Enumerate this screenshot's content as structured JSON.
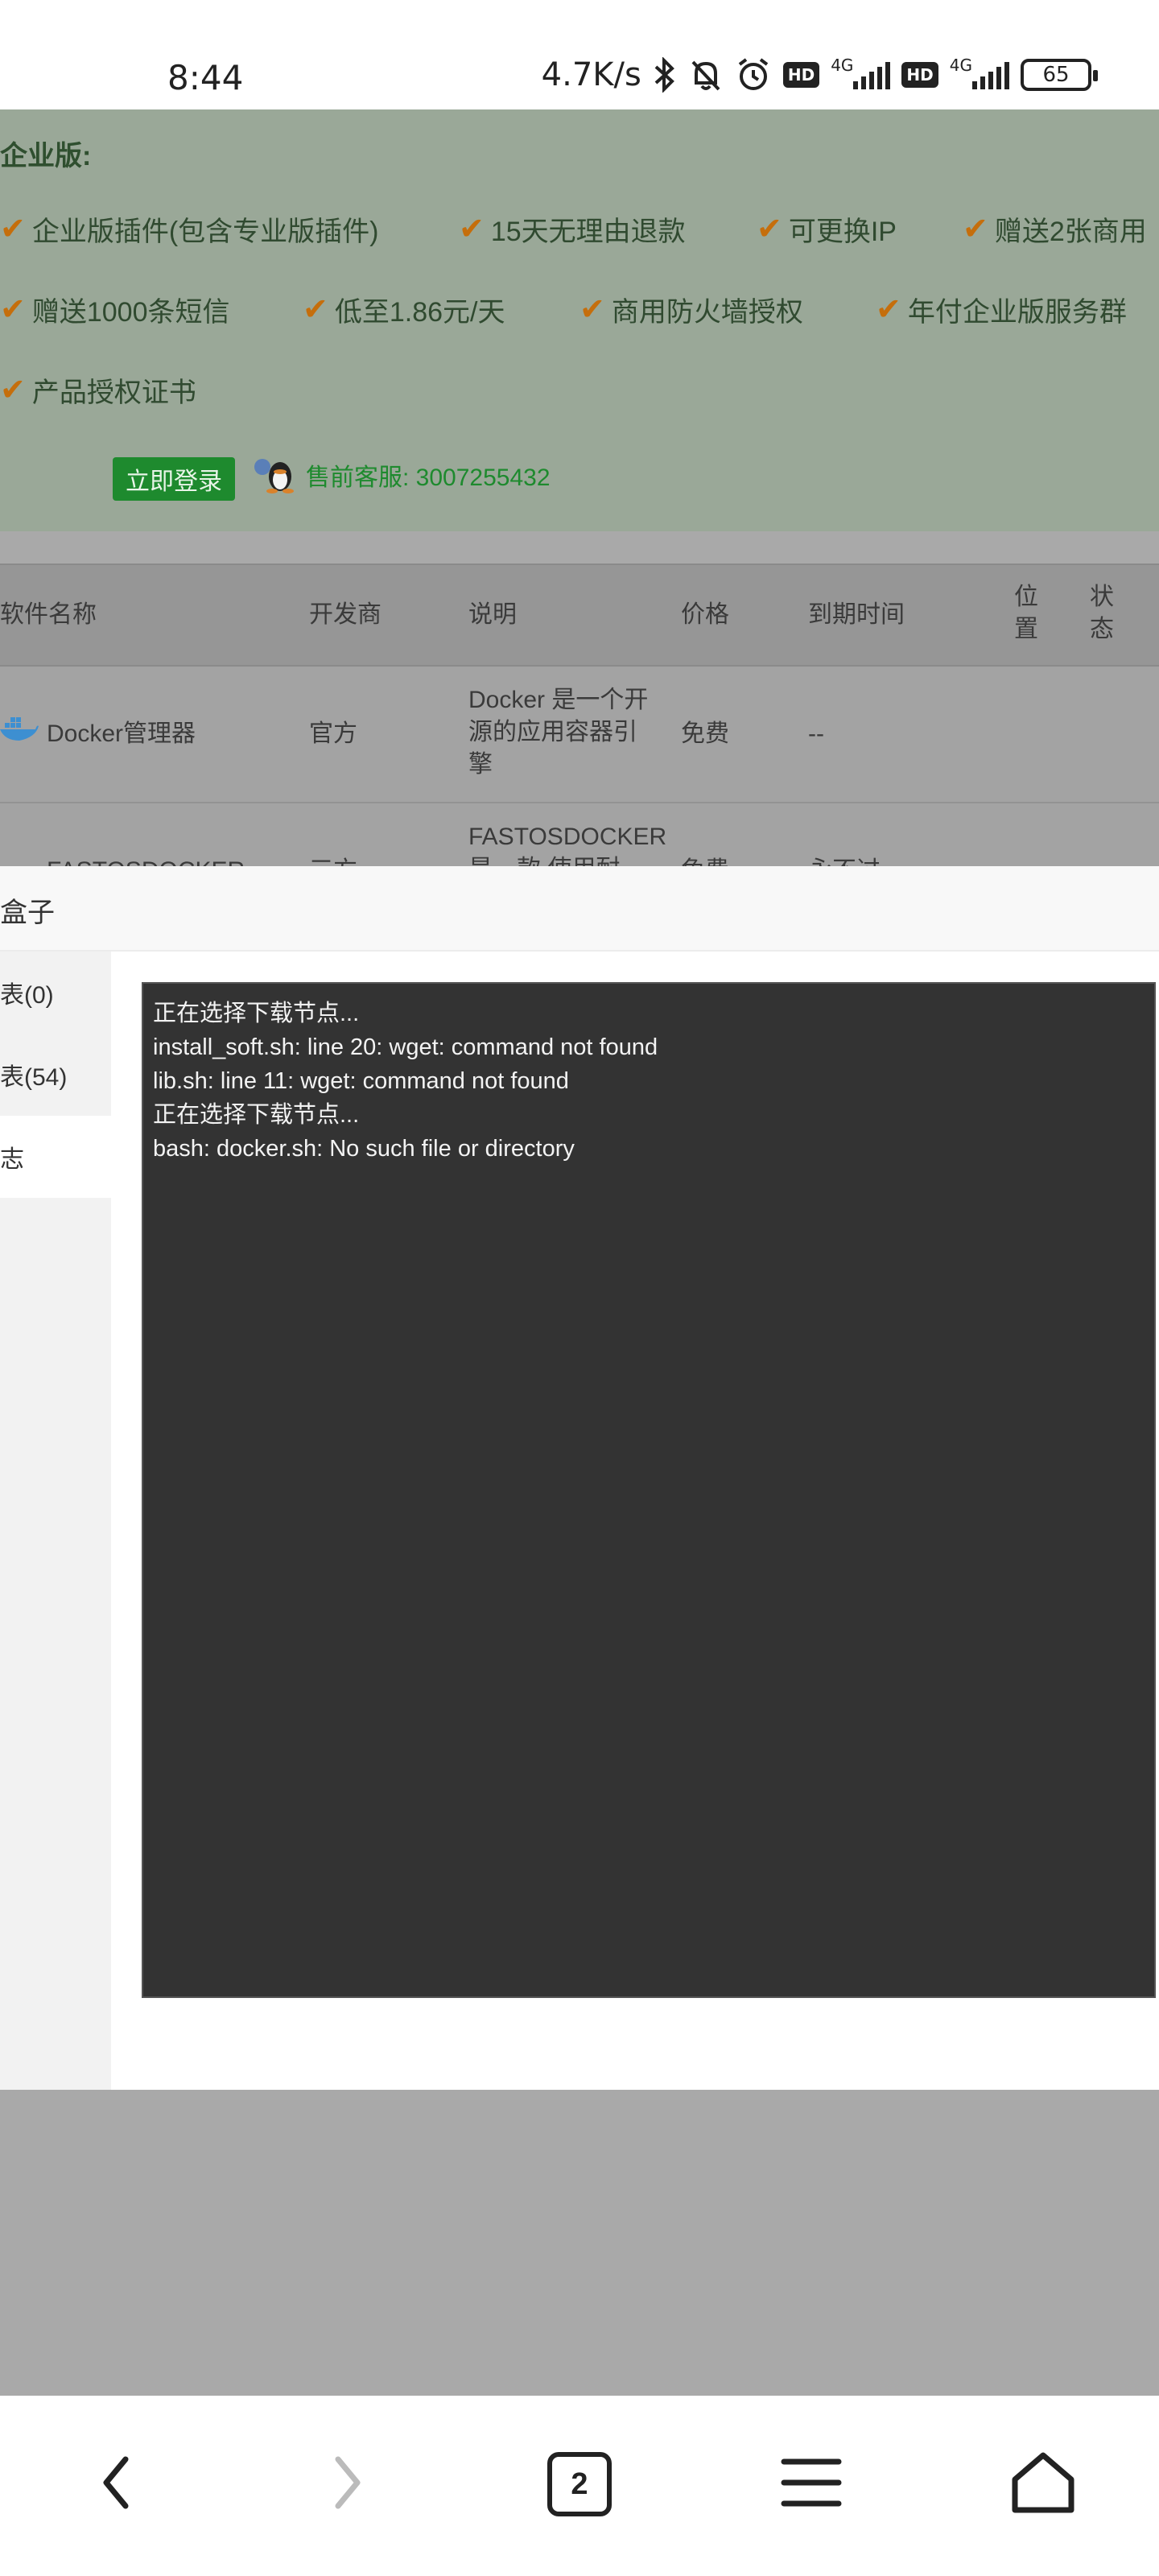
{
  "status_bar": {
    "time": "8:44",
    "net_speed": "4.7K/s",
    "network_1": "4G",
    "network_2": "4G",
    "hd_label": "HD",
    "battery": "65",
    "icons": [
      "bluetooth-icon",
      "mute-bell-icon",
      "alarm-icon",
      "hd-icon",
      "signal-icon",
      "hd-icon",
      "signal-icon",
      "battery-icon"
    ]
  },
  "promo": {
    "title": "企业版:",
    "features": [
      "企业版插件(包含专业版插件)",
      "15天无理由退款",
      "可更换IP",
      "赠送2张商用",
      "赠送1000条短信",
      "低至1.86元/天",
      "商用防火墙授权",
      "年付企业版服务群",
      "产品授权证书"
    ],
    "login_button": "立即登录",
    "sales_contact": "售前客服: 3007255432",
    "accent_color": "#1e8a2e",
    "check_color": "#c56e0c"
  },
  "table": {
    "headers": {
      "name": "软件名称",
      "developer": "开发商",
      "description": "说明",
      "price": "价格",
      "expiry": "到期时间",
      "position": "位置",
      "status": "状态"
    },
    "rows": [
      {
        "name": "Docker管理器",
        "developer": "官方",
        "description": "Docker 是一个开源的应用容器引擎",
        "price": "免费",
        "expiry": "--"
      },
      {
        "name": "FASTOSDOCKER",
        "developer": "三方",
        "description": "FASTOSDOCKER 是一款 使用耐",
        "price": "免费",
        "expiry": "永不过"
      }
    ]
  },
  "modal": {
    "title": "盒子",
    "sidebar": [
      {
        "label": "表(0)",
        "active": false
      },
      {
        "label": "表(54)",
        "active": false
      },
      {
        "label": "志",
        "active": true
      }
    ],
    "log_lines": [
      "正在选择下载节点...",
      "install_soft.sh: line 20: wget: command not found",
      "lib.sh: line 11: wget: command not found",
      "正在选择下载节点...",
      "bash: docker.sh: No such file or directory"
    ]
  },
  "navbar": {
    "tab_count": "2",
    "icons": [
      "back-icon",
      "forward-icon",
      "tabs-icon",
      "menu-icon",
      "home-icon"
    ]
  }
}
